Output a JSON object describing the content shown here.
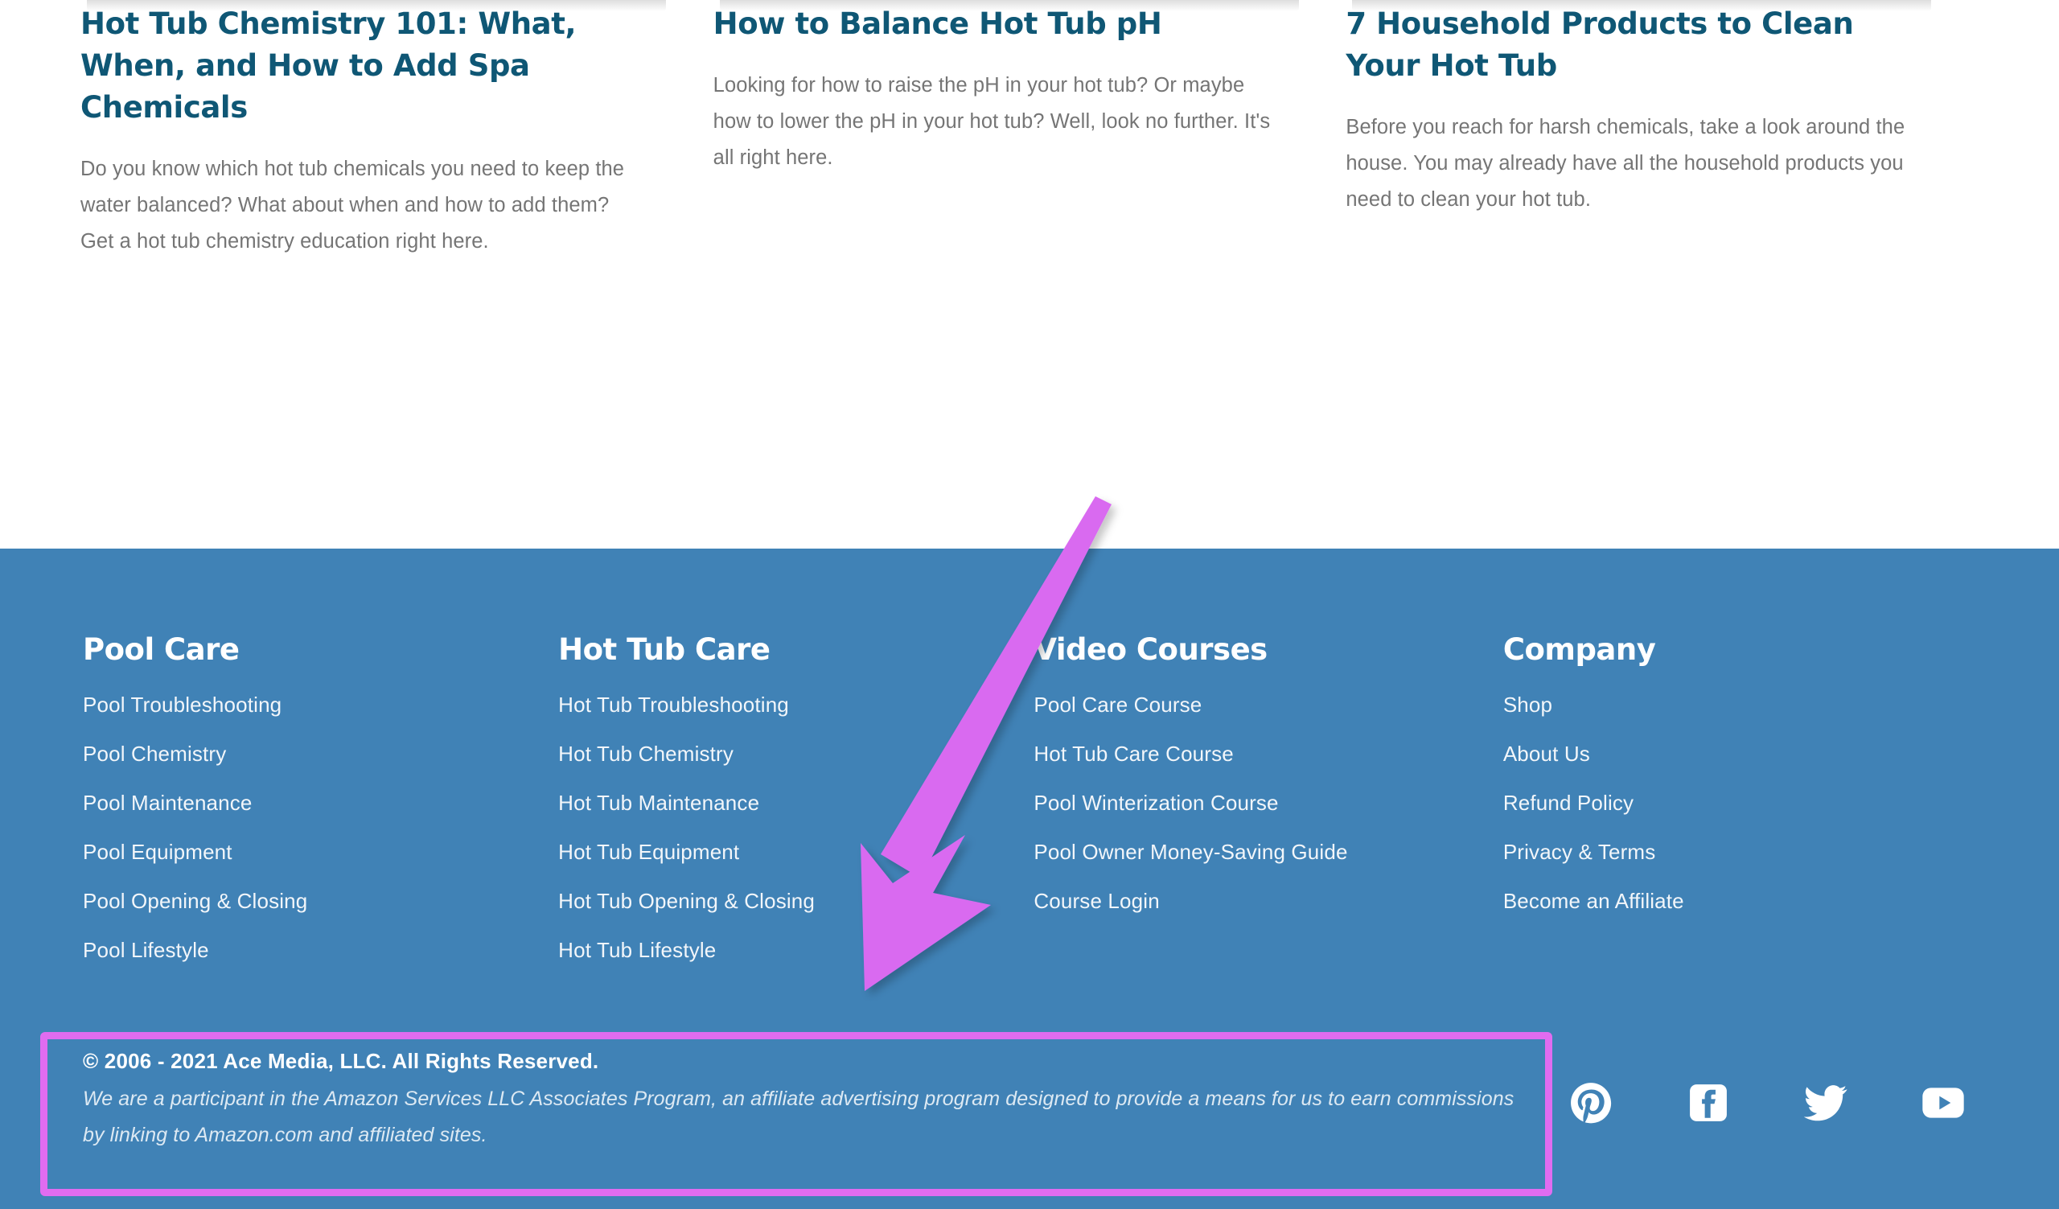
{
  "articles": [
    {
      "title": "Hot Tub Chemistry 101: What, When, and How to Add Spa Chemicals",
      "excerpt": "Do you know which hot tub chemicals you need to keep the water balanced? What about when and how to add them? Get a hot tub chemistry education right here."
    },
    {
      "title": "How to Balance Hot Tub pH",
      "excerpt": "Looking for how to raise the pH in your hot tub? Or maybe how to lower the pH in your hot tub? Well, look no further. It's all right here."
    },
    {
      "title": "7 Household Products to Clean Your Hot Tub",
      "excerpt": "Before you reach for harsh chemicals, take a look around the house. You may already have all the household products you need to clean your hot tub."
    }
  ],
  "footer": {
    "columns": [
      {
        "title": "Pool Care",
        "links": [
          "Pool Troubleshooting",
          "Pool Chemistry",
          "Pool Maintenance",
          "Pool Equipment",
          "Pool Opening & Closing",
          "Pool Lifestyle"
        ]
      },
      {
        "title": "Hot Tub Care",
        "links": [
          "Hot Tub Troubleshooting",
          "Hot Tub Chemistry",
          "Hot Tub Maintenance",
          "Hot Tub Equipment",
          "Hot Tub Opening & Closing",
          "Hot Tub Lifestyle"
        ]
      },
      {
        "title": "Video Courses",
        "links": [
          "Pool Care Course",
          "Hot Tub Care Course",
          "Pool Winterization Course",
          "Pool Owner Money-Saving Guide",
          "Course Login"
        ]
      },
      {
        "title": "Company",
        "links": [
          "Shop",
          "About Us",
          "Refund Policy",
          "Privacy & Terms",
          "Become an Affiliate"
        ]
      }
    ],
    "legal": {
      "copyright": "© 2006 - 2021 Ace Media, LLC. All Rights Reserved.",
      "disclaimer": "We are a participant in the Amazon Services LLC Associates Program, an affiliate advertising program designed to provide a means for us to earn commissions by linking to Amazon.com and affiliated sites."
    },
    "socials": [
      {
        "name": "pinterest-icon",
        "label": "Pinterest"
      },
      {
        "name": "facebook-icon",
        "label": "Facebook"
      },
      {
        "name": "twitter-icon",
        "label": "Twitter"
      },
      {
        "name": "youtube-icon",
        "label": "YouTube"
      }
    ]
  },
  "annotation": {
    "arrow_color": "#d96bf0",
    "box_color": "#e06cf0",
    "arrow_start": "1372,615",
    "arrow_tip": "1080,1235"
  },
  "colors": {
    "footer_bg": "#4082b6",
    "heading": "#0f5775",
    "body_text": "#757575",
    "link_text": "#f2f6fa",
    "page_bg": "#ffffff"
  }
}
